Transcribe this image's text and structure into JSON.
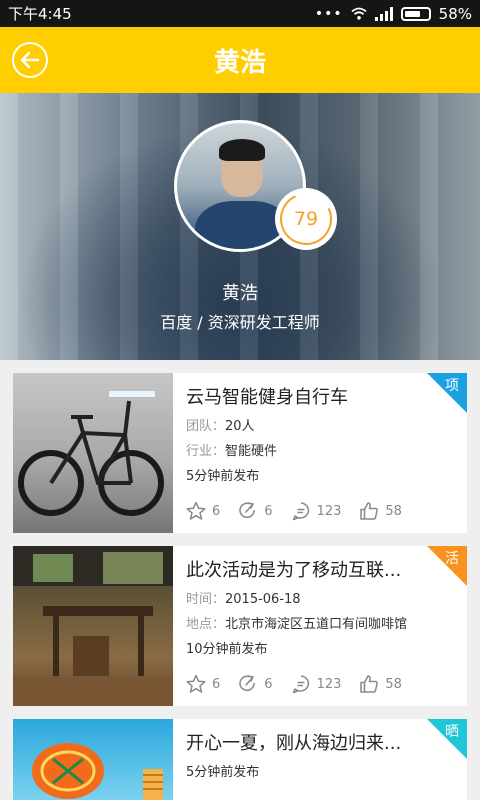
{
  "status_bar": {
    "time": "下午4:45",
    "dots": "•••",
    "battery": "58%"
  },
  "app_bar": {
    "title": "黄浩"
  },
  "profile": {
    "score": "79",
    "name": "黄浩",
    "job": "百度 / 资深研发工程师"
  },
  "cards": [
    {
      "title": "云马智能健身自行车",
      "line1_label": "团队：",
      "line1_value": "20人",
      "line2_label": "行业：",
      "line2_value": "智能硬件",
      "posted": "5分钟前发布",
      "tag": "项",
      "tag_color": "#1ba1e2",
      "stars": "6",
      "shares": "6",
      "comments": "123",
      "likes": "58"
    },
    {
      "title": "此次活动是为了移动互联...",
      "line1_label": "时间：",
      "line1_value": "2015-06-18",
      "line2_label": "地点：",
      "line2_value": "北京市海淀区五道口有间咖啡馆",
      "posted": "10分钟前发布",
      "tag": "活",
      "tag_color": "#f7931e",
      "stars": "6",
      "shares": "6",
      "comments": "123",
      "likes": "58"
    },
    {
      "title": "开心一夏，刚从海边归来...",
      "posted": "5分钟前发布",
      "tag": "晒",
      "tag_color": "#1fc6d6"
    }
  ]
}
